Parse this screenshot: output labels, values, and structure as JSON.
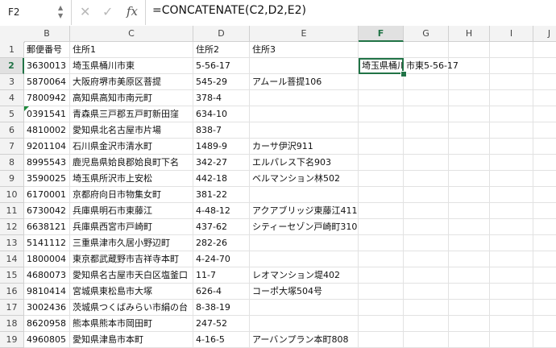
{
  "name_box": {
    "value": "F2"
  },
  "formula_bar": {
    "formula": "=CONCATENATE(C2,D2,E2)",
    "fx_label": "fx",
    "cancel_glyph": "✕",
    "confirm_glyph": "✓"
  },
  "columns": [
    "B",
    "C",
    "D",
    "E",
    "F",
    "G",
    "H",
    "I",
    "J"
  ],
  "active_column": "F",
  "active_row": 2,
  "rows": [
    {
      "num": "1",
      "b": "郵便番号",
      "c": "住所1",
      "d": "住所2",
      "e": "住所3"
    },
    {
      "num": "2",
      "b": "3630013",
      "c": "埼玉県桶川市東",
      "d": "5-56-17",
      "e": ""
    },
    {
      "num": "3",
      "b": "5870064",
      "c": "大阪府堺市美原区菩提",
      "d": "545-29",
      "e": "アムール菩提106"
    },
    {
      "num": "4",
      "b": "7800942",
      "c": "高知県高知市南元町",
      "d": "378-4",
      "e": ""
    },
    {
      "num": "5",
      "b": "0391541",
      "c": "青森県三戸郡五戸町新田窪",
      "d": "634-10",
      "e": ""
    },
    {
      "num": "6",
      "b": "4810002",
      "c": "愛知県北名古屋市片場",
      "d": "838-7",
      "e": ""
    },
    {
      "num": "7",
      "b": "9201104",
      "c": "石川県金沢市清水町",
      "d": "1489-9",
      "e": "カーサ伊沢911"
    },
    {
      "num": "8",
      "b": "8995543",
      "c": "鹿児島県姶良郡姶良町下名",
      "d": "342-27",
      "e": "エルパレス下名903"
    },
    {
      "num": "9",
      "b": "3590025",
      "c": "埼玉県所沢市上安松",
      "d": "442-18",
      "e": "ベルマンション林502"
    },
    {
      "num": "10",
      "b": "6170001",
      "c": "京都府向日市物集女町",
      "d": "381-22",
      "e": ""
    },
    {
      "num": "11",
      "b": "6730042",
      "c": "兵庫県明石市東藤江",
      "d": "4-48-12",
      "e": "アクアブリッジ東藤江411"
    },
    {
      "num": "12",
      "b": "6638121",
      "c": "兵庫県西宮市戸崎町",
      "d": "437-62",
      "e": "シティーセゾン戸崎町310"
    },
    {
      "num": "13",
      "b": "5141112",
      "c": "三重県津市久居小野辺町",
      "d": "282-26",
      "e": ""
    },
    {
      "num": "14",
      "b": "1800004",
      "c": "東京都武蔵野市吉祥寺本町",
      "d": "4-24-70",
      "e": ""
    },
    {
      "num": "15",
      "b": "4680073",
      "c": "愛知県名古屋市天白区塩釜口",
      "d": "11-7",
      "e": "レオマンション堤402"
    },
    {
      "num": "16",
      "b": "9810414",
      "c": "宮城県東松島市大塚",
      "d": "626-4",
      "e": "コーポ大塚504号"
    },
    {
      "num": "17",
      "b": "3002436",
      "c": "茨城県つくばみらい市絹の台",
      "d": "8-38-19",
      "e": ""
    },
    {
      "num": "18",
      "b": "8620958",
      "c": "熊本県熊本市岡田町",
      "d": "247-52",
      "e": ""
    },
    {
      "num": "19",
      "b": "4960805",
      "c": "愛知県津島市本町",
      "d": "4-16-5",
      "e": "アーバンプラン本町808"
    }
  ],
  "f2_value": "埼玉県桶川市東5-56-17",
  "f2_visible": "埼玉県桶川",
  "f2_overflow": "市東5-56-17",
  "colors": {
    "accent": "#217346",
    "error_triangle": "#1e8a3c"
  }
}
